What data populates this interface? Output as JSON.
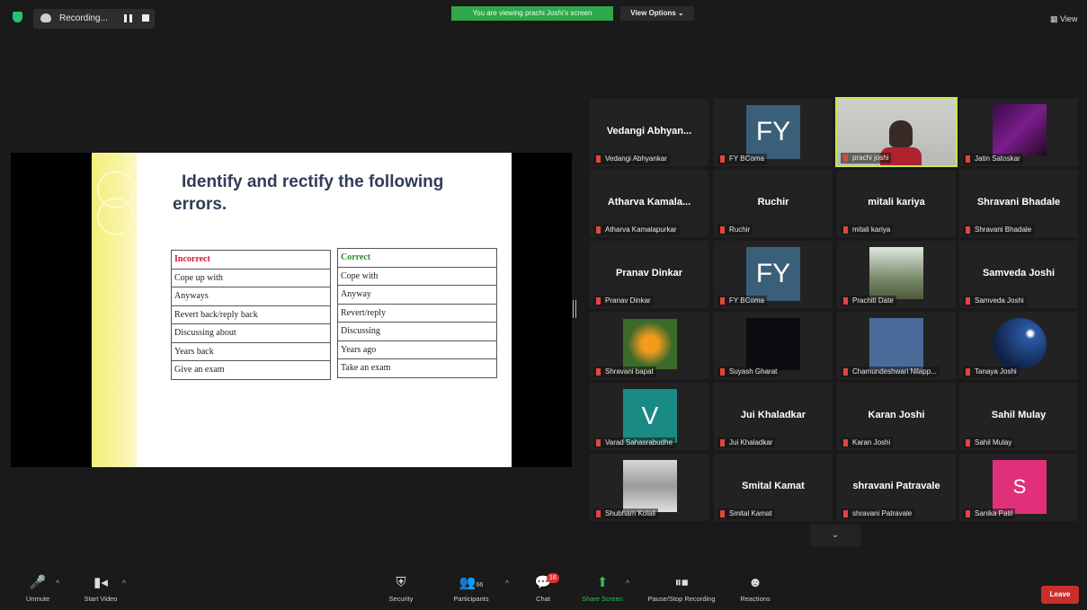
{
  "topbar": {
    "recording_label": "Recording...",
    "viewing_banner": "You are viewing prachi Joshi's screen",
    "view_options": "View Options",
    "view_label": "View"
  },
  "slide": {
    "title_line1": "Identify and rectify the following",
    "title_line2": "errors.",
    "incorrect_header": "Incorrect",
    "correct_header": "Correct",
    "incorrect_rows": [
      "Cope up with",
      "Anyways",
      "Revert back/reply back",
      "Discussing about",
      "Years back",
      "Give an exam"
    ],
    "correct_rows": [
      "Cope with",
      "Anyway",
      "Revert/reply",
      "Discussing",
      "Years ago",
      "Take an exam"
    ]
  },
  "participants": [
    {
      "name": "Vedangi Abhyankar",
      "display": "Vedangi Abhyan..."
    },
    {
      "name": "FY BComa",
      "avatar": "FY"
    },
    {
      "name": "prachi joshi",
      "video": true
    },
    {
      "name": "Jatin Satoskar",
      "image": "art"
    },
    {
      "name": "Atharva Kamalapurkar",
      "display": "Atharva Kamala..."
    },
    {
      "name": "Ruchir",
      "display": "Ruchir"
    },
    {
      "name": "mitali kariya",
      "display": "mitali kariya"
    },
    {
      "name": "Shravani Bhadale",
      "display": "Shravani Bhadale"
    },
    {
      "name": "Pranav Dinkar",
      "display": "Pranav Dinkar"
    },
    {
      "name": "FY BComa",
      "avatar": "FY"
    },
    {
      "name": "Prachiti Date",
      "image": "photo"
    },
    {
      "name": "Samveda Joshi",
      "display": "Samveda Joshi"
    },
    {
      "name": "Shravani bapat",
      "image": "flower"
    },
    {
      "name": "Suyash Gharat",
      "image": "dark"
    },
    {
      "name": "Chamundeshwari Nilapp...",
      "image": "blue"
    },
    {
      "name": "Tanaya Joshi",
      "image": "night"
    },
    {
      "name": "Varad Sahasrabudhe",
      "avatar": "V"
    },
    {
      "name": "Jui Khaladkar",
      "display": "Jui Khaladkar"
    },
    {
      "name": "Karan Joshi",
      "display": "Karan Joshi"
    },
    {
      "name": "Sahil Mulay",
      "display": "Sahil Mulay"
    },
    {
      "name": "Shubham Kolali",
      "image": "tree"
    },
    {
      "name": "Smital Kamat",
      "display": "Smital Kamat"
    },
    {
      "name": "shravani Patravale",
      "display": "shravani Patravale"
    },
    {
      "name": "Sanika Patil",
      "avatar": "S"
    }
  ],
  "toolbar": {
    "unmute": "Unmute",
    "start_video": "Start Video",
    "security": "Security",
    "participants": "Participants",
    "participants_count": "66",
    "chat": "Chat",
    "chat_badge": "16",
    "share_screen": "Share Screen",
    "pause_stop": "Pause/Stop Recording",
    "reactions": "Reactions",
    "leave": "Leave"
  },
  "colors": {
    "accent_green": "#2fa84a",
    "active_speaker": "#c3e84e",
    "leave_red": "#c9302c",
    "avatar_fy": "#3a5f79",
    "avatar_v": "#198a84",
    "avatar_s": "#e1307a"
  },
  "icons": {
    "shield": "shield-icon",
    "recording": "cloud-icon",
    "mic": "mic-muted-icon",
    "video": "video-off-icon",
    "security": "shield-icon",
    "participants": "people-icon",
    "chat": "chat-icon",
    "share": "share-arrow-icon",
    "record": "pause-stop-icon",
    "reactions": "smiley-icon",
    "grid": "grid-icon",
    "chevron": "chevron-down-icon"
  }
}
